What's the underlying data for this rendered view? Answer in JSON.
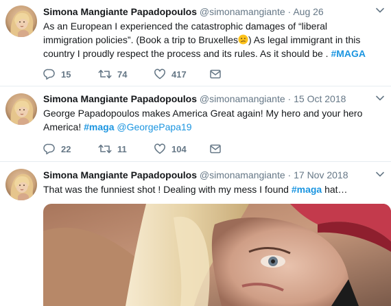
{
  "tweets": [
    {
      "name": "Simona Mangiante Papadopoulos",
      "handle": "@simonamangiante",
      "separator": "·",
      "date": "Aug 26",
      "text_1": "As an European I experienced the catastrophic damages of “liberal immigration policies”. (Book a trip to Bruxelles",
      "emoji": "confused-face",
      "text_2": ") As legal immigrant in this country I proudly respect the process and its rules. As it should be . ",
      "hashtag": "#MAGA",
      "replies": "15",
      "retweets": "74",
      "likes": "417"
    },
    {
      "name": "Simona Mangiante Papadopoulos",
      "handle": "@simonamangiante",
      "separator": "·",
      "date": "15 Oct 2018",
      "text_1": "George Papadopoulos makes America Great again! My hero and your hero America! ",
      "hashtag": "#maga",
      "mention": "@GeorgePapa19",
      "replies": "22",
      "retweets": "11",
      "likes": "104"
    },
    {
      "name": "Simona Mangiante Papadopoulos",
      "handle": "@simonamangiante",
      "separator": "·",
      "date": "17 Nov 2018",
      "text_1": "That was the funniest shot ! Dealing with my mess I found ",
      "hashtag": "#maga",
      "text_2": " hat…"
    }
  ],
  "icons": {
    "reply": "reply-icon",
    "retweet": "retweet-icon",
    "like": "heart-icon",
    "message": "envelope-icon",
    "menu": "chevron-down-icon"
  },
  "colors": {
    "link": "#1b95e0",
    "muted": "#657786",
    "text": "#14171a",
    "divider": "#e6ecf0"
  }
}
